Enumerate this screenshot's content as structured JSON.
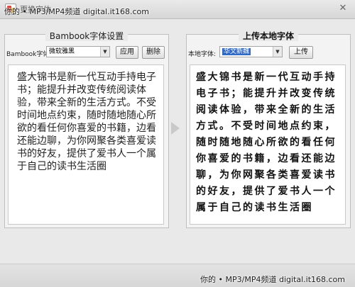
{
  "window": {
    "title_text": "更换字体",
    "close_glyph": "✕"
  },
  "watermark": {
    "text": "你的 • MP3/MP4频道  digital.it168.com"
  },
  "left_panel": {
    "title": "Bambook字体设置",
    "label": "Bambook字体:",
    "font_value": "微软雅黑",
    "apply_label": "应用",
    "delete_label": "删除",
    "sample_text": "盛大锦书是新一代互动手持电子书；能提升并改变传统阅读体验，带来全新的生活方式。不受时间地点约束，随时随地随心所欲的看任何你喜爱的书籍，边看还能边聊，为你网聚各类喜爱读书的好友，提供了爱书人一个属于自己的读书生活圈"
  },
  "right_panel": {
    "title": "上传本地字体",
    "label": "本地字体:",
    "font_value": "华文新魏",
    "upload_label": "上传",
    "sample_text": "盛大锦书是新一代互动手持电子书；能提升并改变传统阅读体验，带来全新的生活方式。不受时间地点约束，随时随地随心所欲的看任何你喜爱的书籍，边看还能边聊，为你网聚各类喜爱读书的好友，提供了爱书人一个属于自己的读书生活圈"
  },
  "icons": {
    "dropdown": "▼"
  },
  "colors": {
    "selection": "#3169c6",
    "panel_bg": "#f3f3f3",
    "window_bg": "#e9e9e9"
  }
}
